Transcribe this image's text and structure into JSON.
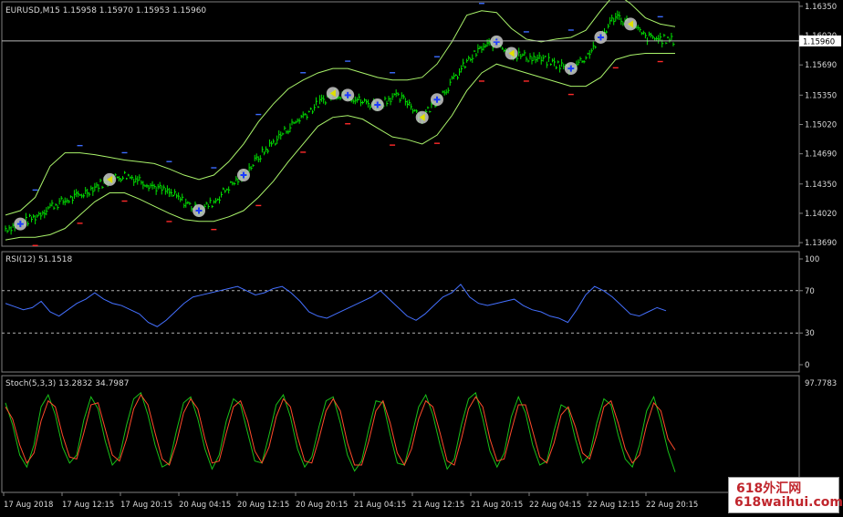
{
  "chart_data": [
    {
      "type": "line",
      "panel": "price",
      "symbol_label": "EURUSD,M15  1.15958 1.15970 1.15953 1.15960",
      "price_scale": [
        1.1369,
        1.1402,
        1.1435,
        1.1469,
        1.1502,
        1.1535,
        1.1569,
        1.1602,
        1.1635
      ],
      "price_tick_labels": [
        "1.13690",
        "1.14020",
        "1.14350",
        "1.14690",
        "1.15020",
        "1.15350",
        "1.15690",
        "1.16020",
        "1.16350"
      ],
      "current_price": 1.1596,
      "current_price_label": "1.15960",
      "ylim": [
        1.1365,
        1.164
      ],
      "close": [
        1.1385,
        1.139,
        1.1398,
        1.141,
        1.1416,
        1.1422,
        1.1432,
        1.144,
        1.1445,
        1.144,
        1.1432,
        1.1425,
        1.1415,
        1.1405,
        1.1415,
        1.1432,
        1.1445,
        1.1465,
        1.1482,
        1.1498,
        1.1512,
        1.1525,
        1.1537,
        1.1535,
        1.1527,
        1.1524,
        1.1534,
        1.1528,
        1.151,
        1.153,
        1.155,
        1.1572,
        1.1588,
        1.1595,
        1.1582,
        1.1578,
        1.1575,
        1.157,
        1.1565,
        1.1578,
        1.16,
        1.1625,
        1.1615,
        1.16,
        1.1598,
        1.1596
      ],
      "bb_upper": [
        1.14,
        1.1405,
        1.142,
        1.1455,
        1.147,
        1.147,
        1.1468,
        1.1465,
        1.1462,
        1.146,
        1.1458,
        1.1452,
        1.1445,
        1.144,
        1.1445,
        1.146,
        1.148,
        1.1505,
        1.1525,
        1.1542,
        1.1552,
        1.156,
        1.1565,
        1.1565,
        1.156,
        1.1555,
        1.1552,
        1.1552,
        1.1555,
        1.157,
        1.1595,
        1.1625,
        1.163,
        1.1628,
        1.161,
        1.1598,
        1.1595,
        1.1598,
        1.16,
        1.1608,
        1.163,
        1.165,
        1.1638,
        1.1622,
        1.1615,
        1.1612
      ],
      "bb_lower": [
        1.1372,
        1.1375,
        1.1375,
        1.1378,
        1.1385,
        1.14,
        1.1415,
        1.1425,
        1.1425,
        1.1418,
        1.141,
        1.1402,
        1.1395,
        1.1393,
        1.1393,
        1.1398,
        1.1405,
        1.142,
        1.1438,
        1.146,
        1.148,
        1.15,
        1.151,
        1.1512,
        1.1508,
        1.1498,
        1.1488,
        1.1485,
        1.148,
        1.149,
        1.1512,
        1.154,
        1.156,
        1.157,
        1.1565,
        1.156,
        1.1555,
        1.155,
        1.1545,
        1.1545,
        1.1555,
        1.1575,
        1.158,
        1.1582,
        1.1582,
        1.1582
      ],
      "xlabels": [
        "17 Aug 2018",
        "17 Aug 12:15",
        "17 Aug 20:15",
        "20 Aug 04:15",
        "20 Aug 12:15",
        "20 Aug 20:15",
        "21 Aug 04:15",
        "21 Aug 12:15",
        "21 Aug 20:15",
        "22 Aug 04:15",
        "22 Aug 12:15",
        "22 Aug 20:15"
      ],
      "grid": false,
      "series_colors": {
        "candles": "#00e000",
        "bollinger": "#a9f36a",
        "signal_buy": "#3b6bff",
        "signal_sell": "#ff2a2a",
        "marker": "#c8c8c8"
      }
    },
    {
      "type": "line",
      "panel": "rsi",
      "label": "RSI(12) 51.1518",
      "ylim": [
        0,
        100
      ],
      "levels": [
        30,
        70
      ],
      "tick_labels": [
        "100",
        "70",
        "30",
        "0"
      ],
      "values": [
        58,
        55,
        52,
        54,
        60,
        50,
        46,
        52,
        58,
        62,
        68,
        62,
        58,
        56,
        52,
        48,
        40,
        36,
        42,
        50,
        58,
        64,
        66,
        68,
        70,
        72,
        74,
        70,
        66,
        68,
        72,
        74,
        68,
        60,
        50,
        46,
        44,
        48,
        52,
        56,
        60,
        64,
        70,
        62,
        54,
        46,
        42,
        48,
        56,
        64,
        68,
        76,
        64,
        58,
        56,
        58,
        60,
        62,
        56,
        52,
        50,
        46,
        44,
        40,
        52,
        66,
        74,
        70,
        64,
        56,
        48,
        46,
        50,
        54,
        51
      ],
      "color": "#4470ff"
    },
    {
      "type": "line",
      "panel": "stochastic",
      "label": "Stoch(5,3,3) 13.2832 34.7987",
      "tick_labels": [
        "97.7783"
      ],
      "ylim": [
        0,
        100
      ],
      "series": [
        {
          "values": [
            82,
            60,
            30,
            18,
            40,
            78,
            90,
            70,
            38,
            22,
            30,
            65,
            88,
            76,
            44,
            20,
            28,
            60,
            86,
            92,
            70,
            40,
            18,
            22,
            54,
            82,
            88,
            66,
            36,
            16,
            30,
            64,
            86,
            80,
            52,
            24,
            22,
            50,
            80,
            90,
            68,
            36,
            18,
            28,
            58,
            84,
            88,
            62,
            30,
            14,
            24,
            56,
            84,
            82,
            50,
            22,
            20,
            48,
            78,
            90,
            70,
            40,
            16,
            26,
            60,
            86,
            92,
            66,
            34,
            18,
            32,
            68,
            88,
            72,
            40,
            20,
            24,
            54,
            80,
            76,
            46,
            22,
            30,
            62,
            86,
            80,
            50,
            26,
            18,
            40,
            74,
            88,
            64,
            34,
            13
          ],
          "color": "#18c018"
        },
        {
          "values": [
            78,
            66,
            40,
            22,
            32,
            64,
            84,
            78,
            50,
            28,
            26,
            52,
            80,
            82,
            56,
            30,
            24,
            46,
            76,
            90,
            80,
            52,
            26,
            20,
            42,
            72,
            86,
            76,
            46,
            22,
            24,
            52,
            78,
            84,
            64,
            34,
            22,
            38,
            68,
            86,
            78,
            48,
            24,
            22,
            46,
            74,
            86,
            74,
            42,
            20,
            20,
            44,
            74,
            84,
            62,
            32,
            20,
            36,
            66,
            84,
            78,
            52,
            24,
            20,
            46,
            76,
            88,
            78,
            46,
            24,
            26,
            54,
            80,
            80,
            54,
            28,
            22,
            42,
            70,
            78,
            58,
            32,
            26,
            50,
            78,
            84,
            62,
            36,
            22,
            30,
            60,
            82,
            74,
            46,
            35
          ],
          "color": "#ff4a2a"
        }
      ]
    }
  ],
  "watermark": {
    "line1": "618外汇网",
    "line2": "618waihui.com"
  }
}
